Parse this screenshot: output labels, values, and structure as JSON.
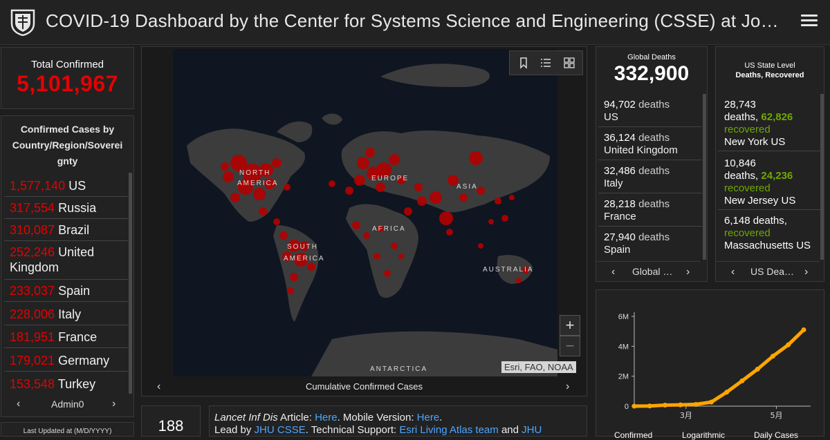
{
  "header": {
    "title": "COVID-19 Dashboard by the Center for Systems Science and Engineering (CSSE) at Jo…"
  },
  "total": {
    "label": "Total Confirmed",
    "value": "5,101,967"
  },
  "country_panel": {
    "title": "Confirmed Cases by Country/Region/Sovereignty",
    "rows": [
      {
        "num": "1,577,140",
        "name": "US"
      },
      {
        "num": "317,554",
        "name": "Russia"
      },
      {
        "num": "310,087",
        "name": "Brazil"
      },
      {
        "num": "252,246",
        "name": "United Kingdom"
      },
      {
        "num": "233,037",
        "name": "Spain"
      },
      {
        "num": "228,006",
        "name": "Italy"
      },
      {
        "num": "181,951",
        "name": "France"
      },
      {
        "num": "179,021",
        "name": "Germany"
      },
      {
        "num": "153,548",
        "name": "Turkey"
      }
    ],
    "nav_label": "Admin0"
  },
  "last_updated": {
    "label": "Last Updated at (M/D/YYYY)"
  },
  "map": {
    "labels": {
      "north_america": "NORTH AMERICA",
      "europe": "EUROPE",
      "asia": "ASIA",
      "africa": "AFRICA",
      "south_america": "SOUTH AMERICA",
      "australia": "AUSTRALIA",
      "antarctica": "ANTARCTICA"
    },
    "attribution": "Esri, FAO, NOAA",
    "caption": "Cumulative Confirmed Cases",
    "zoom_in": "+",
    "zoom_out": "−"
  },
  "global_deaths": {
    "label": "Global Deaths",
    "value": "332,900",
    "rows": [
      {
        "num": "94,702",
        "label": "deaths",
        "name": "US"
      },
      {
        "num": "36,124",
        "label": "deaths",
        "name": "United Kingdom"
      },
      {
        "num": "32,486",
        "label": "deaths",
        "name": "Italy"
      },
      {
        "num": "28,218",
        "label": "deaths",
        "name": "France"
      },
      {
        "num": "27,940",
        "label": "deaths",
        "name": "Spain"
      }
    ],
    "nav_label": "Global …"
  },
  "us_state": {
    "title_line1": "US State Level",
    "title_line2": "Deaths, Recovered",
    "rows": [
      {
        "deaths": "28,743",
        "deaths_label": "deaths,",
        "recovered": "62,826",
        "recovered_label": "recovered",
        "name": "New York US"
      },
      {
        "deaths": "10,846",
        "deaths_label": "deaths,",
        "recovered": "24,236",
        "recovered_label": "recovered",
        "name": "New Jersey US"
      },
      {
        "deaths": "6,148",
        "deaths_label": "deaths,",
        "recovered": "",
        "recovered_label": "recovered",
        "name": "Massachusetts US"
      }
    ],
    "nav_label": "US Dea…"
  },
  "chart_data": {
    "type": "line",
    "x": [
      "1/22",
      "2/1",
      "2/15",
      "3/1",
      "3/10",
      "3/20",
      "4/1",
      "4/10",
      "4/20",
      "5/1",
      "5/10",
      "5/21"
    ],
    "series": [
      {
        "values": [
          555,
          12000,
          69000,
          88000,
          118000,
          272000,
          932000,
          1690000,
          2470000,
          3340000,
          4100000,
          5101967
        ]
      }
    ],
    "x_tick_labels": [
      "3月",
      "5月"
    ],
    "y_tick_labels": [
      "0",
      "2M",
      "4M",
      "6M"
    ],
    "ylim": [
      0,
      6000000
    ],
    "grid": false
  },
  "chart_tabs": [
    "Confirmed",
    "Logarithmic",
    "Daily Cases"
  ],
  "bottom": {
    "count": "188",
    "line1_prefix": "Lancet Inf Dis",
    "line1_mid": " Article: ",
    "line1_link1": "Here",
    "line1_mid2": ". Mobile Version: ",
    "line1_link2": "Here",
    "line1_end": ".",
    "line2_prefix": "Lead by ",
    "line2_link1": "JHU CSSE",
    "line2_mid": ". Technical Support: ",
    "line2_link2": "Esri Living Atlas team",
    "line2_mid2": " and ",
    "line2_link3": "JHU"
  },
  "colors": {
    "accent_red": "#e60000",
    "recovered_green": "#70a800",
    "chart_orange": "#ffa500",
    "link_blue": "#4da6ff"
  }
}
